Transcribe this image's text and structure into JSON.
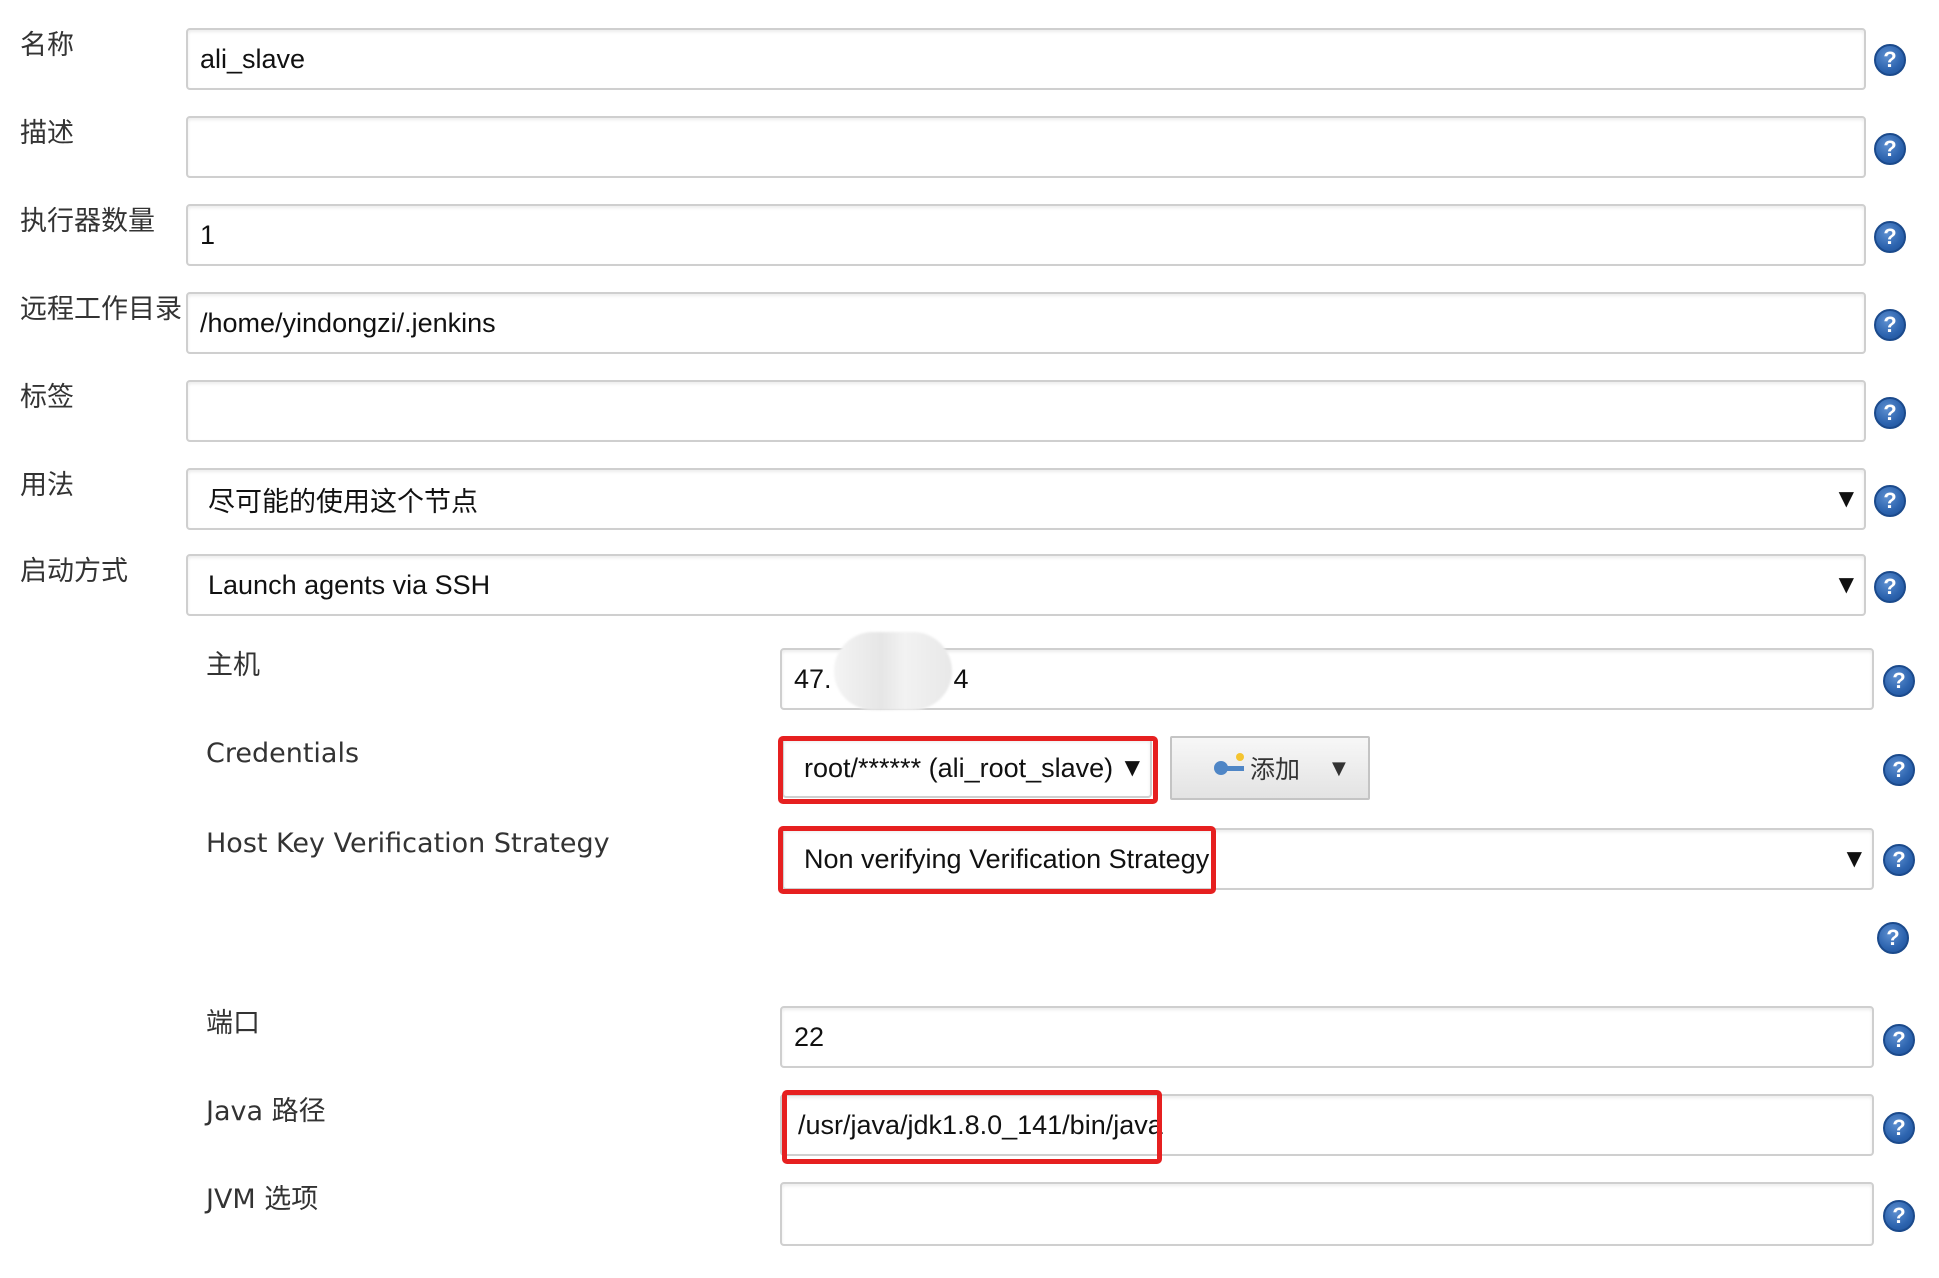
{
  "fields": {
    "name": {
      "label": "名称",
      "value": "ali_slave"
    },
    "description": {
      "label": "描述",
      "value": ""
    },
    "executors": {
      "label": "执行器数量",
      "value": "1"
    },
    "remote_dir": {
      "label": "远程工作目录",
      "value": "/home/yindongzi/.jenkins"
    },
    "labels": {
      "label": "标签",
      "value": ""
    },
    "usage": {
      "label": "用法",
      "value": "尽可能的使用这个节点"
    },
    "launch_method": {
      "label": "启动方式",
      "value": "Launch agents via SSH"
    }
  },
  "ssh": {
    "host": {
      "label": "主机",
      "value_prefix": "47.",
      "value_suffix": "4"
    },
    "credentials": {
      "label": "Credentials",
      "value": "root/****** (ali_root_slave)",
      "add_label": "添加"
    },
    "host_key": {
      "label": "Host Key Verification Strategy",
      "value": "Non verifying Verification Strategy"
    },
    "port": {
      "label": "端口",
      "value": "22"
    },
    "java_path": {
      "label": "Java 路径",
      "value": "/usr/java/jdk1.8.0_141/bin/java"
    },
    "jvm_options": {
      "label": "JVM 选项",
      "value": ""
    }
  },
  "icons": {
    "help": "?",
    "dropdown": "▼"
  },
  "colors": {
    "highlight": "#e62020",
    "help_blue": "#2c63ae"
  }
}
